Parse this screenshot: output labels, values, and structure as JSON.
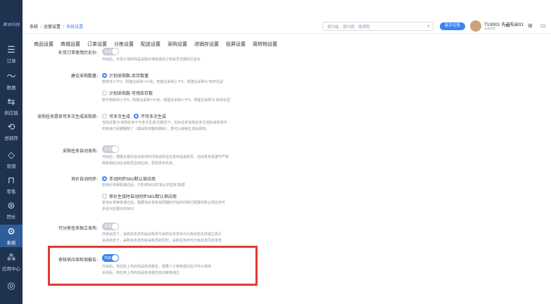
{
  "sidebar": {
    "logo": "聚单科技",
    "items": [
      {
        "label": "订单",
        "icon": "☰"
      },
      {
        "label": "数据",
        "icon": "〜"
      },
      {
        "label": "供应链",
        "icon": "⇆"
      },
      {
        "label": "进销存",
        "icon": "⟲"
      },
      {
        "label": "营销",
        "icon": "◇"
      },
      {
        "label": "零售",
        "icon": "⊓"
      },
      {
        "label": "团长",
        "icon": "⊛"
      },
      {
        "label": "系统",
        "icon": "⚙"
      },
      {
        "label": "应用中心",
        "icon": "⁂"
      },
      {
        "label": "",
        "icon": "◎"
      }
    ]
  },
  "breadcrumb": [
    "系统",
    "运营设置",
    "系统设置"
  ],
  "search_placeholder": "搜功能、搜问题、搜课程",
  "new_button": "新手引导",
  "user": {
    "name": "T10001 先进先出01",
    "id": "xjxc01"
  },
  "tabs": [
    "商品设置",
    "商城设置",
    "订单设置",
    "分拣设置",
    "配送设置",
    "采购设置",
    "进销存设置",
    "投屏设置",
    "周转物设置"
  ],
  "rows": {
    "r1": {
      "label": "补货订单使用历史价:",
      "toggle": "关闭",
      "desc": "开启后，补货订单的商品采购价使用该店订单会员日期的历史价"
    },
    "r2": {
      "label": "建议采购数量:",
      "opt1": "计划采购数-库存数量",
      "opt1_desc": "若库存小于0，则建议采购=计划，若建议采购小于0，则建议采购为'库存充足'",
      "opt2": "计划采购数-可用库存数",
      "opt2_desc": "若可用库存小于0，则建议采购=计划，若建议采购小于0，则建议采购为'库存充足'"
    },
    "r3": {
      "label": "采购任务是否可多次生成采购单:",
      "opt1": "可多次生成",
      "opt2": "不可多次生成",
      "desc1": "当前设置为'采购任务不可多次生成'的模式下，如对应的采购任务生成的采购单中",
      "desc2": "的条目已经被删除了（或采购单整体删除），则可以继续生成采购单。"
    },
    "r4": {
      "label": "采购任务自动发布:",
      "toggle": "关闭",
      "desc1": "开启后，根据设置的自动发布时间将采购任务发布给采购员。自动发布需遵守严率",
      "desc2": "规和相应对应采购员及供应商，否则发布失败。"
    },
    "r5": {
      "label": "询价自动同步:",
      "opt1": "手动同步SKU默认供应商",
      "opt1_desc": "若询价单审核通过后，不影响SKU的'默认供应商'数据",
      "opt2": "审价生效时自动同步SKU默认供应商",
      "opt2_desc1": "若询价单审核通过后，根据询价单有效周期的开始时间将已配置的默认供应商可",
      "opt2_desc2": "步至对应报价的SKU"
    },
    "r6": {
      "label": "代分拣任务独立发布:",
      "toggle": "关闭",
      "desc1": "开启状态下，采购任务发布给采购员与采购任务发布代分拣状态支持独立执行",
      "desc2": "关闭状态下，采购任务发布给采购员的同时，采购任务的代分拣状态同步发布"
    },
    "r7": {
      "label": "审核供应商检测报告:",
      "toggle": "开启",
      "desc1": "开启后，供应商上传的商品检测报告，需要人工审核通过后才可以使用",
      "desc2": "关闭后，供应商上传的商品检测报告自动审核通过"
    }
  },
  "colors": {
    "sidebar_bg": "#1f3350",
    "accent": "#3b82f6",
    "highlight": "#e53935"
  }
}
